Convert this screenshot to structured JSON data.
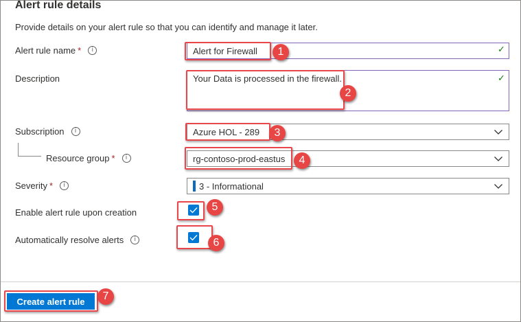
{
  "section": {
    "title": "Alert rule details",
    "description": "Provide details on your alert rule so that you can identify and manage it later."
  },
  "fields": {
    "alert_rule_name": {
      "label": "Alert rule name",
      "required": "*",
      "value": "Alert for Firewall"
    },
    "description": {
      "label": "Description",
      "value": "Your Data is processed in the firewall."
    },
    "subscription": {
      "label": "Subscription",
      "value": "Azure HOL - 289"
    },
    "resource_group": {
      "label": "Resource group",
      "required": "*",
      "value": "rg-contoso-prod-eastus"
    },
    "severity": {
      "label": "Severity",
      "required": "*",
      "value": "3 - Informational"
    },
    "enable_on_creation": {
      "label": "Enable alert rule upon creation",
      "checked": true
    },
    "auto_resolve": {
      "label": "Automatically resolve alerts",
      "checked": true
    }
  },
  "actions": {
    "create_label": "Create alert rule"
  },
  "annotations": [
    "1",
    "2",
    "3",
    "4",
    "5",
    "6",
    "7"
  ],
  "icons": {
    "info": "info-icon",
    "valid": "checkmark-icon",
    "dropdown": "chevron-down-icon",
    "checkbox": "checkbox-checked-icon"
  },
  "colors": {
    "accent": "#0078d4",
    "highlight": "#e8464a",
    "valid": "#107c10",
    "focus_border": "#8764b8",
    "required": "#a4262c"
  }
}
